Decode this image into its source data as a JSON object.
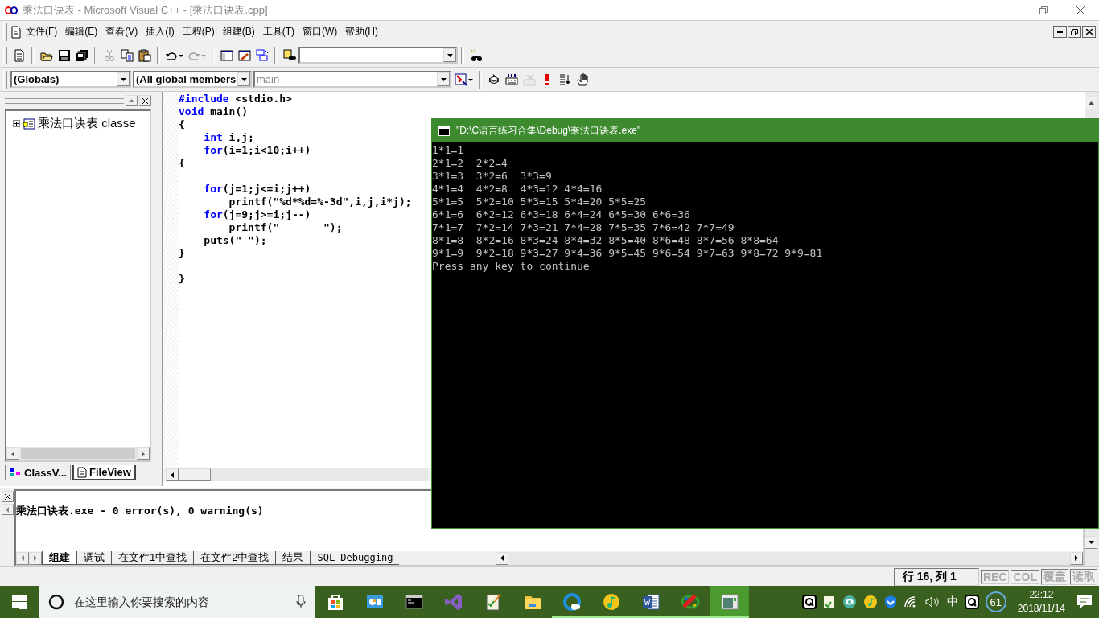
{
  "title_bar": {
    "title": "乘法口诀表 - Microsoft Visual C++ - [乘法口诀表.cpp]"
  },
  "menu_bar": {
    "items": [
      "文件(F)",
      "编辑(E)",
      "查看(V)",
      "插入(I)",
      "工程(P)",
      "组建(B)",
      "工具(T)",
      "窗口(W)",
      "帮助(H)"
    ]
  },
  "toolbar_1": {
    "items": [
      {
        "kind": "new",
        "disabled": false
      },
      {
        "kind": "separator"
      },
      {
        "kind": "open",
        "disabled": false
      },
      {
        "kind": "save",
        "disabled": false
      },
      {
        "kind": "saveall",
        "disabled": false
      },
      {
        "kind": "separator"
      },
      {
        "kind": "cut",
        "disabled": true
      },
      {
        "kind": "copy",
        "disabled": false
      },
      {
        "kind": "paste",
        "disabled": false
      },
      {
        "kind": "separator"
      },
      {
        "kind": "undo",
        "disabled": false
      },
      {
        "kind": "redo",
        "disabled": true
      },
      {
        "kind": "separator"
      },
      {
        "kind": "workspace",
        "disabled": false
      },
      {
        "kind": "output",
        "disabled": false
      },
      {
        "kind": "windows",
        "disabled": false
      },
      {
        "kind": "separator"
      },
      {
        "kind": "findfiles",
        "disabled": false
      },
      {
        "kind": "combo"
      },
      {
        "kind": "separator"
      },
      {
        "kind": "binoculars",
        "disabled": false
      }
    ]
  },
  "toolbar_2": {
    "items": [
      {
        "kind": "combo",
        "value": "(Globals)",
        "disabled": false
      },
      {
        "kind": "combo",
        "value": "(All global members",
        "disabled": false
      },
      {
        "kind": "combo",
        "value": "main",
        "disabled": true
      },
      {
        "kind": "wizard",
        "disabled": false
      },
      {
        "kind": "separator"
      },
      {
        "kind": "compile",
        "disabled": false
      },
      {
        "kind": "build",
        "disabled": false
      },
      {
        "kind": "stop",
        "disabled": true
      },
      {
        "kind": "execute",
        "disabled": false
      },
      {
        "kind": "breakpoint",
        "disabled": false
      },
      {
        "kind": "hand",
        "disabled": false
      }
    ]
  },
  "workspace": {
    "tree": [
      {
        "label": "乘法口诀表 classe",
        "expanded": false
      }
    ],
    "tabs": [
      {
        "label": "ClassV...",
        "selected": false
      },
      {
        "label": "FileView",
        "selected": true
      }
    ]
  },
  "editor": {
    "lines": [
      {
        "kind": "code",
        "parts": [
          {
            "kind": "keyword",
            "text": "#include"
          },
          {
            "kind": "plain",
            "text": " <stdio.h>"
          }
        ]
      },
      {
        "kind": "code",
        "parts": [
          {
            "kind": "keyword",
            "text": "void"
          },
          {
            "kind": "plain",
            "text": " main()"
          }
        ]
      },
      {
        "kind": "code",
        "parts": [
          {
            "kind": "plain",
            "text": "{"
          }
        ]
      },
      {
        "kind": "code",
        "parts": [
          {
            "kind": "keyword",
            "text": "    int"
          },
          {
            "kind": "plain",
            "text": " i,j;"
          }
        ]
      },
      {
        "kind": "code",
        "parts": [
          {
            "kind": "keyword",
            "text": "    for"
          },
          {
            "kind": "plain",
            "text": "(i=1;i<10;i++)"
          }
        ]
      },
      {
        "kind": "code",
        "parts": [
          {
            "kind": "plain",
            "text": "{"
          }
        ]
      },
      {
        "kind": "blank"
      },
      {
        "kind": "code",
        "parts": [
          {
            "kind": "keyword",
            "text": "    for"
          },
          {
            "kind": "plain",
            "text": "(j=1;j<=i;j++)"
          }
        ]
      },
      {
        "kind": "code",
        "parts": [
          {
            "kind": "plain",
            "text": "        printf(\"%d*%d=%-3d\",i,j,i*j);"
          }
        ]
      },
      {
        "kind": "code",
        "parts": [
          {
            "kind": "keyword",
            "text": "    for"
          },
          {
            "kind": "plain",
            "text": "(j=9;j>=i;j--)"
          }
        ]
      },
      {
        "kind": "code",
        "parts": [
          {
            "kind": "plain",
            "text": "        printf(\"       \");"
          }
        ]
      },
      {
        "kind": "code",
        "parts": [
          {
            "kind": "plain",
            "text": "    puts(\" \");"
          }
        ]
      },
      {
        "kind": "code",
        "parts": [
          {
            "kind": "plain",
            "text": "}"
          }
        ]
      },
      {
        "kind": "blank"
      },
      {
        "kind": "code",
        "parts": [
          {
            "kind": "plain",
            "text": "}"
          }
        ]
      }
    ]
  },
  "output": {
    "lines": [
      "乘法口诀表.exe - 0 error(s), 0 warning(s)"
    ],
    "tabs": [
      {
        "label": "组建",
        "selected": true
      },
      {
        "label": "调试",
        "selected": false
      },
      {
        "label": "在文件1中查找",
        "selected": false
      },
      {
        "label": "在文件2中查找",
        "selected": false
      },
      {
        "label": "结果",
        "selected": false
      },
      {
        "label": "SQL Debugging",
        "selected": false
      }
    ]
  },
  "status_bar": {
    "position": "行 16, 列 1",
    "indicators": [
      {
        "label": "REC",
        "on": false
      },
      {
        "label": "COL",
        "on": false
      },
      {
        "label": "覆盖",
        "on": false
      },
      {
        "label": "读取",
        "on": false
      }
    ]
  },
  "console": {
    "title": "\"D:\\C语言练习合集\\Debug\\乘法口诀表.exe\"",
    "lines": [
      "1*1=1",
      "2*1=2  2*2=4",
      "3*1=3  3*2=6  3*3=9",
      "4*1=4  4*2=8  4*3=12 4*4=16",
      "5*1=5  5*2=10 5*3=15 5*4=20 5*5=25",
      "6*1=6  6*2=12 6*3=18 6*4=24 6*5=30 6*6=36",
      "7*1=7  7*2=14 7*3=21 7*4=28 7*5=35 7*6=42 7*7=49",
      "8*1=8  8*2=16 8*3=24 8*4=32 8*5=40 8*6=48 8*7=56 8*8=64",
      "9*1=9  9*2=18 9*3=27 9*4=36 9*5=45 9*6=54 9*7=63 9*8=72 9*9=81",
      "Press any key to continue"
    ]
  },
  "taskbar": {
    "search": {
      "placeholder": "在这里输入你要搜索的内容"
    },
    "apps": [
      {
        "kind": "store",
        "running": false,
        "active": false
      },
      {
        "kind": "photos",
        "running": false,
        "active": false
      },
      {
        "kind": "terminal",
        "running": false,
        "active": false
      },
      {
        "kind": "studio",
        "running": false,
        "active": false
      },
      {
        "kind": "notepad",
        "running": false,
        "active": false
      },
      {
        "kind": "folder",
        "running": false,
        "active": false
      },
      {
        "kind": "browser",
        "running": true,
        "active": false
      },
      {
        "kind": "music",
        "running": true,
        "active": false
      },
      {
        "kind": "word",
        "running": true,
        "active": false
      },
      {
        "kind": "paint",
        "running": true,
        "active": false
      },
      {
        "kind": "ide",
        "running": true,
        "active": true
      }
    ],
    "ime": "中",
    "badge": "61",
    "time": "22:12",
    "date": "2018/11/14"
  }
}
